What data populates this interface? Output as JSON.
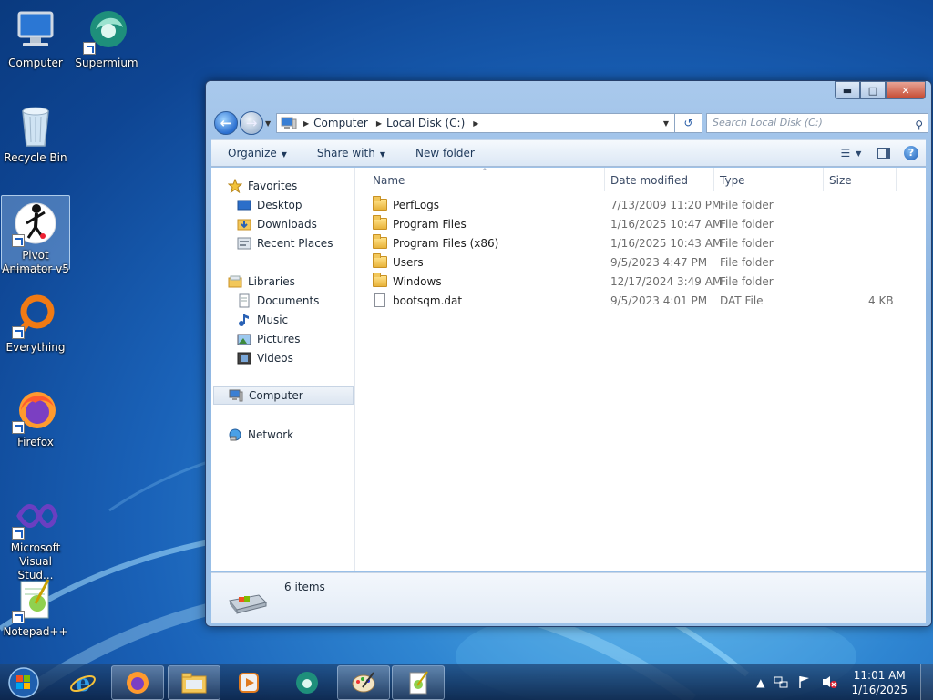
{
  "desktop": {
    "icons": [
      {
        "label": "Computer",
        "icon": "computer-icon"
      },
      {
        "label": "Supermium",
        "icon": "supermium-icon"
      },
      {
        "label": "Recycle Bin",
        "icon": "recycle-bin-icon"
      },
      {
        "label": "Pivot Animator v5",
        "icon": "pivot-animator-icon"
      },
      {
        "label": "Everything",
        "icon": "everything-icon"
      },
      {
        "label": "Firefox",
        "icon": "firefox-icon"
      },
      {
        "label": "Microsoft Visual Stud...",
        "icon": "visual-studio-icon"
      },
      {
        "label": "Notepad++",
        "icon": "notepadpp-icon"
      }
    ]
  },
  "window": {
    "controls": {
      "minimize": "▬",
      "maximize": "□",
      "close": "✕"
    },
    "address": {
      "crumbs": [
        "Computer",
        "Local Disk (C:)"
      ]
    },
    "search": {
      "placeholder": "Search Local Disk (C:)"
    },
    "toolbar": {
      "organize": "Organize",
      "share_with": "Share with",
      "new_folder": "New folder"
    },
    "nav_pane": {
      "favorites": {
        "label": "Favorites",
        "items": [
          "Desktop",
          "Downloads",
          "Recent Places"
        ]
      },
      "libraries": {
        "label": "Libraries",
        "items": [
          "Documents",
          "Music",
          "Pictures",
          "Videos"
        ]
      },
      "computer": "Computer",
      "network": "Network"
    },
    "columns": {
      "name": "Name",
      "date": "Date modified",
      "type": "Type",
      "size": "Size"
    },
    "files": [
      {
        "name": "PerfLogs",
        "date": "7/13/2009 11:20 PM",
        "type": "File folder",
        "size": "",
        "kind": "folder"
      },
      {
        "name": "Program Files",
        "date": "1/16/2025 10:47 AM",
        "type": "File folder",
        "size": "",
        "kind": "folder"
      },
      {
        "name": "Program Files (x86)",
        "date": "1/16/2025 10:43 AM",
        "type": "File folder",
        "size": "",
        "kind": "folder"
      },
      {
        "name": "Users",
        "date": "9/5/2023 4:47 PM",
        "type": "File folder",
        "size": "",
        "kind": "folder"
      },
      {
        "name": "Windows",
        "date": "12/17/2024 3:49 AM",
        "type": "File folder",
        "size": "",
        "kind": "folder"
      },
      {
        "name": "bootsqm.dat",
        "date": "9/5/2023 4:01 PM",
        "type": "DAT File",
        "size": "4 KB",
        "kind": "file"
      }
    ],
    "status": {
      "items_count": "6 items"
    }
  },
  "taskbar": {
    "clock": {
      "time": "11:01 AM",
      "date": "1/16/2025"
    }
  }
}
